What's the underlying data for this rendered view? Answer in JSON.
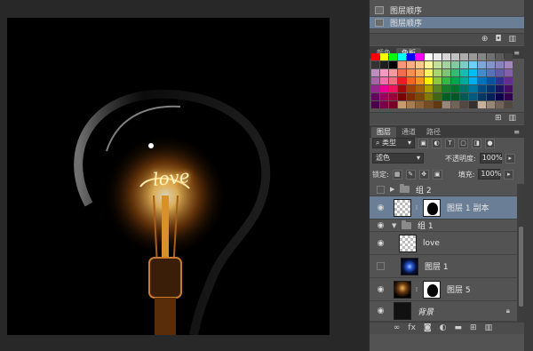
{
  "history": {
    "items": [
      {
        "label": "图层顺序"
      },
      {
        "label": "图层顺序",
        "selected": true
      }
    ],
    "bottom_icons": [
      "new-snapshot-icon",
      "camera-icon",
      "trash-icon"
    ]
  },
  "swatches": {
    "tabs": [
      {
        "label": "颜色",
        "active": false
      },
      {
        "label": "色板",
        "active": true
      }
    ],
    "colors": [
      "#ff0000",
      "#ffff00",
      "#00ff00",
      "#00ffff",
      "#0000ff",
      "#ff00ff",
      "#ffffff",
      "#ebebeb",
      "#d6d6d6",
      "#c2c2c2",
      "#adadad",
      "#999999",
      "#858585",
      "#707070",
      "#5c5c5c",
      "#474747",
      "#333333",
      "#1f1f1f",
      "#000000",
      "#f7977a",
      "#f9ad81",
      "#fdc68a",
      "#fff79a",
      "#c4df9b",
      "#a3d39c",
      "#82ca9d",
      "#7bcdc8",
      "#6ecff6",
      "#7ea7d8",
      "#8493ca",
      "#8882be",
      "#a187be",
      "#bc8dbf",
      "#f49ac2",
      "#f6989d",
      "#f26c4f",
      "#f68e56",
      "#fbaf5d",
      "#fff467",
      "#acd372",
      "#7cc576",
      "#3bb878",
      "#1abbb4",
      "#00bff3",
      "#438cca",
      "#5574b9",
      "#605ca8",
      "#855fa8",
      "#a763a8",
      "#f06eaa",
      "#f26d7d",
      "#ed1c24",
      "#f26522",
      "#f7941d",
      "#fff200",
      "#8dc73f",
      "#39b54a",
      "#00a651",
      "#00a99d",
      "#00aeef",
      "#0072bc",
      "#0054a6",
      "#2e3192",
      "#662d91",
      "#92278f",
      "#ec008c",
      "#ed145b",
      "#9e0b0f",
      "#a0410d",
      "#a36209",
      "#aba000",
      "#598527",
      "#1a7b30",
      "#007236",
      "#00746b",
      "#0076a3",
      "#004b80",
      "#003471",
      "#1b1464",
      "#440e62",
      "#630460",
      "#9e005d",
      "#9e0039",
      "#790000",
      "#7b2e00",
      "#7d4900",
      "#827b00",
      "#406618",
      "#005e20",
      "#005826",
      "#005952",
      "#005b7f",
      "#003663",
      "#002157",
      "#0d004c",
      "#32004b",
      "#4b0049",
      "#7b0046",
      "#7a0026",
      "#c69c6d",
      "#a67c52",
      "#8c6239",
      "#754c24",
      "#603913",
      "#998675",
      "#736357",
      "#534741",
      "#362f2d",
      "#c7b299",
      "#998675",
      "#736357",
      "#534741"
    ],
    "bottom_icons": [
      "new-swatch-icon",
      "trash-icon"
    ]
  },
  "layers": {
    "tabs": [
      {
        "label": "图层",
        "active": true
      },
      {
        "label": "通道",
        "active": false
      },
      {
        "label": "路径",
        "active": false
      }
    ],
    "filter": {
      "label": "类型"
    },
    "filter_icons": [
      "image-filter-icon",
      "adjust-filter-icon",
      "type-filter-icon",
      "shape-filter-icon",
      "smart-filter-icon"
    ],
    "blend_mode": "滤色",
    "opacity_label": "不透明度:",
    "opacity_value": "100%",
    "lock_label": "锁定:",
    "fill_label": "填充:",
    "fill_value": "100%",
    "rows": [
      {
        "name": "组 2",
        "kind": "group",
        "collapsed": true,
        "visible": false
      },
      {
        "name": "图层 1 副本",
        "kind": "layer-mask",
        "visible": true,
        "selected": true
      },
      {
        "name": "组 1",
        "kind": "group",
        "collapsed": false,
        "visible": true
      },
      {
        "name": "love",
        "kind": "layer",
        "thumb": "checker",
        "visible": true,
        "indent": true
      },
      {
        "name": "图层 1",
        "kind": "layer",
        "thumb": "glow",
        "visible": false,
        "indent": true
      },
      {
        "name": "图层 5",
        "kind": "layer-mask",
        "thumb": "bulb",
        "visible": true
      },
      {
        "name": "背景",
        "kind": "background",
        "visible": true,
        "locked": true
      }
    ],
    "bottom_icons": [
      "link-icon",
      "fx-icon",
      "mask-icon",
      "adjustment-icon",
      "folder-icon",
      "new-layer-icon",
      "trash-icon"
    ]
  },
  "canvas": {
    "artwork_text": "love"
  }
}
